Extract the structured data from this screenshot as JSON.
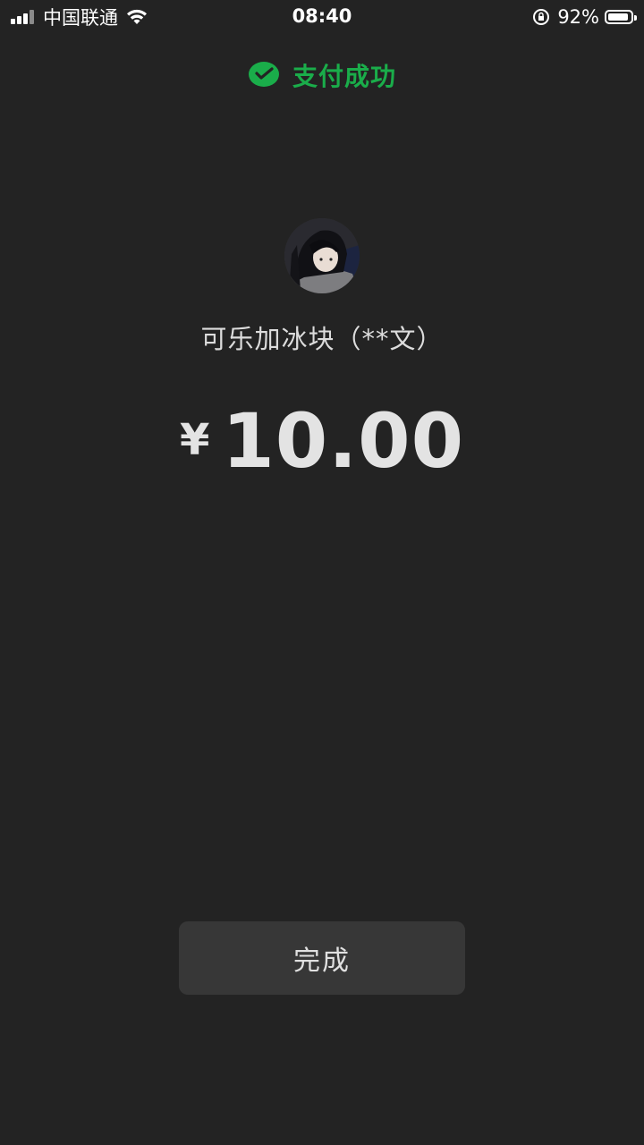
{
  "status_bar": {
    "carrier": "中国联通",
    "time": "08:40",
    "battery_percent": "92%",
    "battery_level": 0.92,
    "signal_bars": 3,
    "icons": [
      "signal-icon",
      "wifi-icon",
      "rotation-lock-icon",
      "battery-icon"
    ]
  },
  "header": {
    "title": "支付成功",
    "icon": "wechat-pay-icon",
    "accent_color": "#1aad4a"
  },
  "payee": {
    "avatar": "anime-avatar",
    "name": "可乐加冰块（**文）"
  },
  "payment": {
    "currency_symbol": "¥",
    "amount": "10.00"
  },
  "actions": {
    "done_label": "完成"
  }
}
